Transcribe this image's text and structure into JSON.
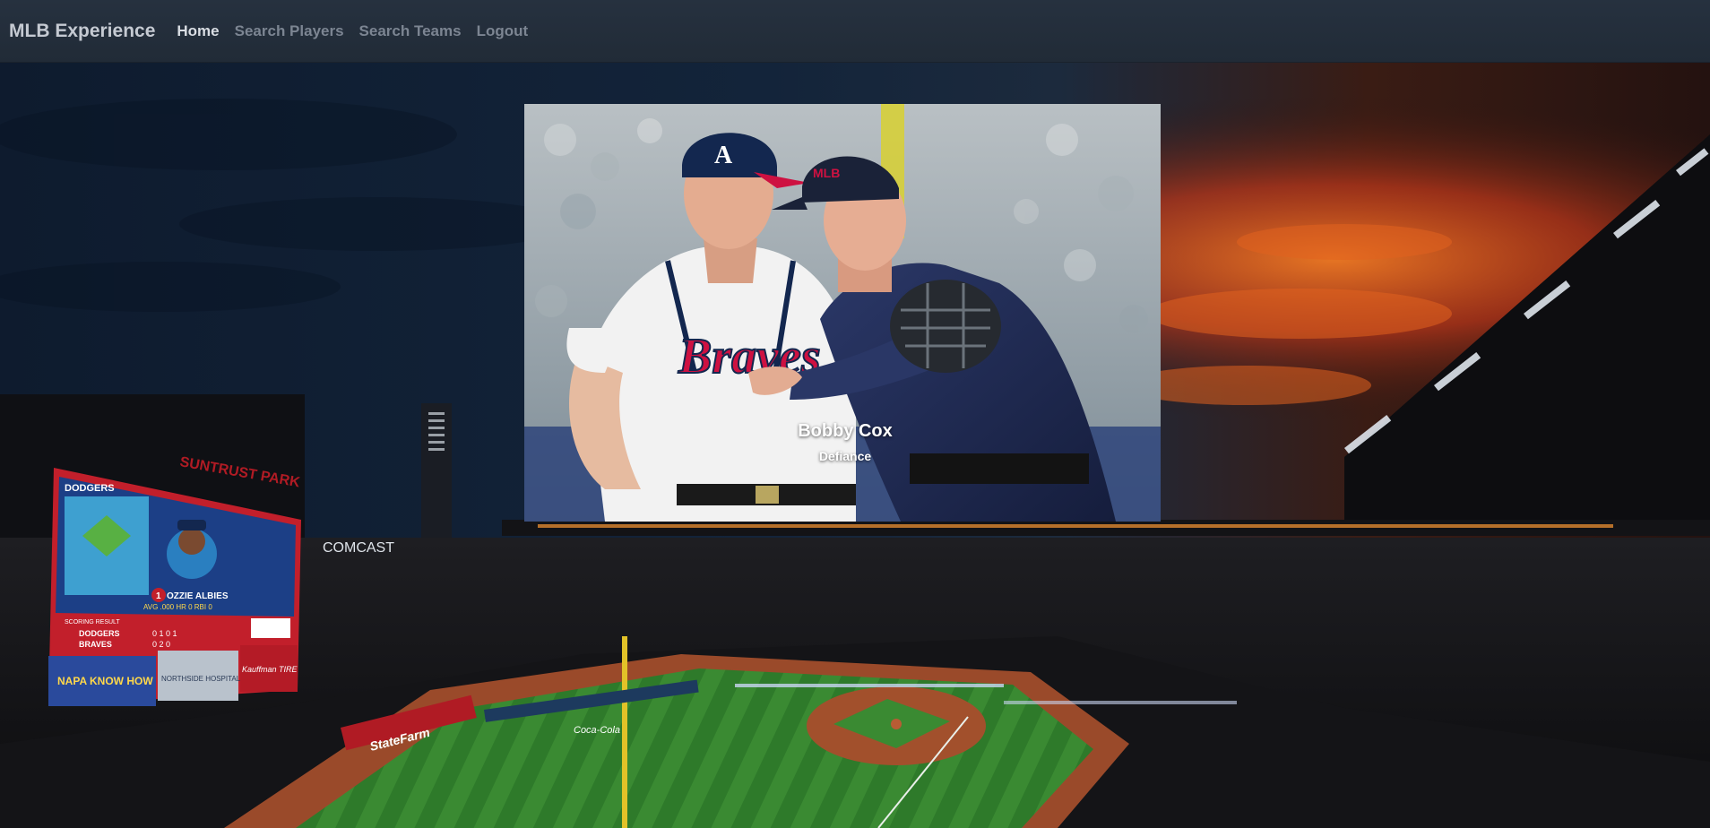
{
  "navbar": {
    "brand": "MLB Experience",
    "links": [
      {
        "label": "Home",
        "active": true
      },
      {
        "label": "Search Players",
        "active": false
      },
      {
        "label": "Search Teams",
        "active": false
      },
      {
        "label": "Logout",
        "active": false
      }
    ]
  },
  "hero": {
    "title": "Bobby Cox",
    "subtitle": "Defiance",
    "jersey_text": "Braves",
    "cap_text": "MLB"
  },
  "scoreboard": {
    "team_top": "DODGERS",
    "team_bottom": "BRAVES",
    "player_number": "1",
    "player_name": "OZZIE ALBIES",
    "stat_line": "AVG .000   HR 0   RBI 0",
    "score_top": "0 1 0 1",
    "score_bottom": "0 2 0",
    "scoring_label": "SCORING RESULT",
    "sponsor_1": "NAPA KNOW HOW",
    "sponsor_2": "NORTHSIDE HOSPITAL",
    "sponsor_3": "Kauffman TIRE",
    "park_sign": "SUNTRUST PARK"
  },
  "stadium_signs": {
    "statefarm": "StateFarm",
    "comcast": "COMCAST",
    "cocacola": "Coca-Cola"
  },
  "colors": {
    "navbar_bg": "#232d3a",
    "brand_text": "#c5cad2",
    "link_active": "#d9dde3",
    "link_inactive": "#7c8592",
    "sky_dark": "#0d1a2c",
    "sunset_orange": "#d9541c",
    "grass_green": "#2f7d2b",
    "dirt": "#9a4a2a",
    "braves_navy": "#13274f",
    "braves_red": "#ce1141"
  }
}
